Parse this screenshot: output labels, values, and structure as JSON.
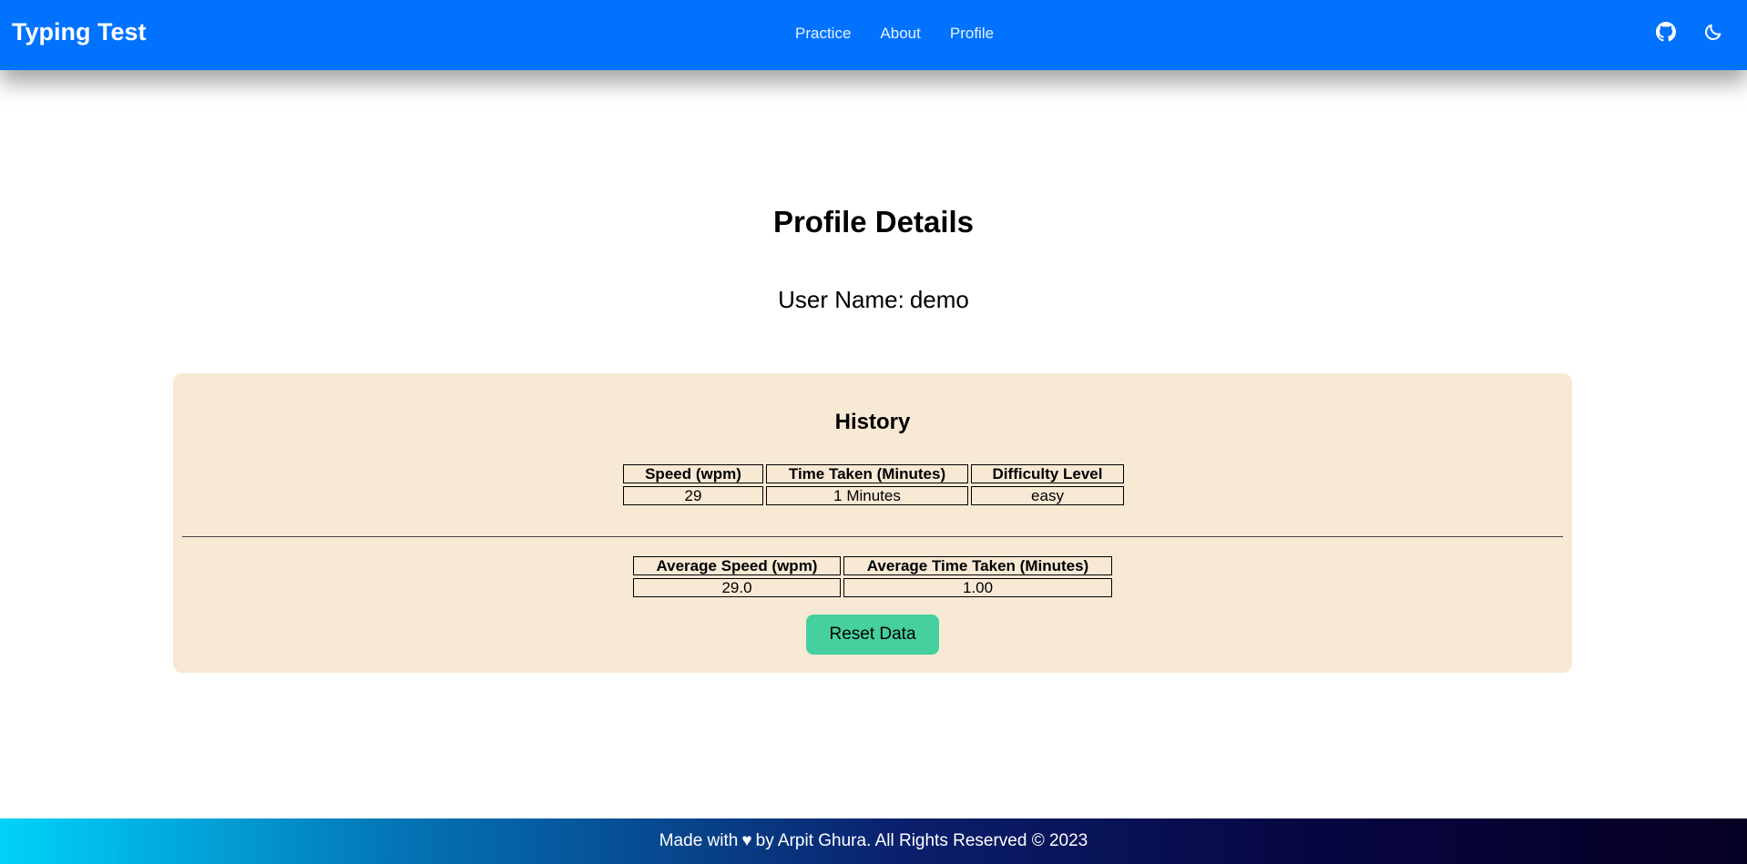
{
  "navbar": {
    "brand": "Typing Test",
    "links": [
      "Practice",
      "About",
      "Profile"
    ],
    "icons": [
      "github-icon",
      "moon-icon"
    ],
    "color": "#0172fe"
  },
  "profile": {
    "title": "Profile Details",
    "user_label": "User Name:",
    "user_value": "demo"
  },
  "history": {
    "title": "History",
    "columns": [
      "Speed (wpm)",
      "Time Taken (Minutes)",
      "Difficulty Level"
    ],
    "rows": [
      [
        "29",
        "1 Minutes",
        "easy"
      ]
    ],
    "average_columns": [
      "Average Speed (wpm)",
      "Average Time Taken (Minutes)"
    ],
    "average_values": [
      "29.0",
      "1.00"
    ],
    "reset_label": "Reset Data",
    "card_color": "#f8e9d5",
    "button_color": "#46d09e"
  },
  "footer": {
    "prefix": "Made with",
    "heart": "♥",
    "suffix": "by Arpit Ghura. All Rights Reserved © 2023"
  }
}
